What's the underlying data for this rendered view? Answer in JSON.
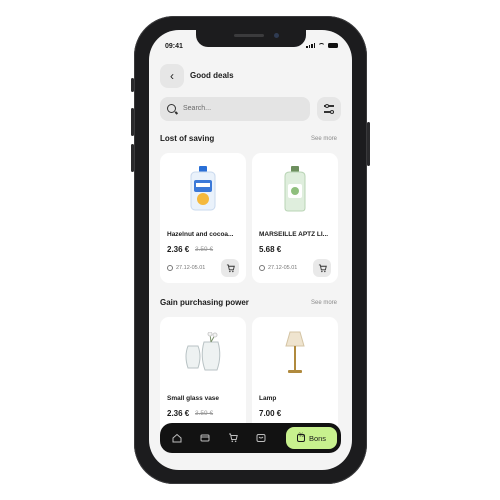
{
  "status_bar": {
    "time": "09:41"
  },
  "header": {
    "title": "Good deals"
  },
  "search": {
    "placeholder": "Search..."
  },
  "sections": [
    {
      "title": "Lost of saving",
      "see_more": "See more",
      "products": [
        {
          "name": "Hazelnut and cocoa...",
          "price": "2.36 €",
          "old_price": "3.59 €",
          "date": "27.12-05.01"
        },
        {
          "name": "MARSEILLE APTZ LI...",
          "price": "5.68 €",
          "old_price": "",
          "date": "27.12-05.01"
        }
      ]
    },
    {
      "title": "Gain purchasing power",
      "see_more": "See more",
      "products": [
        {
          "name": "Small glass vase",
          "price": "2.36 €",
          "old_price": "3.59 €"
        },
        {
          "name": "Lamp",
          "price": "7.00 €",
          "old_price": ""
        }
      ]
    }
  ],
  "bottom_nav": {
    "items": [
      "home-icon",
      "card-icon",
      "cart-icon",
      "store-icon"
    ],
    "active_label": "Bons",
    "accent": "#c8f18e"
  }
}
